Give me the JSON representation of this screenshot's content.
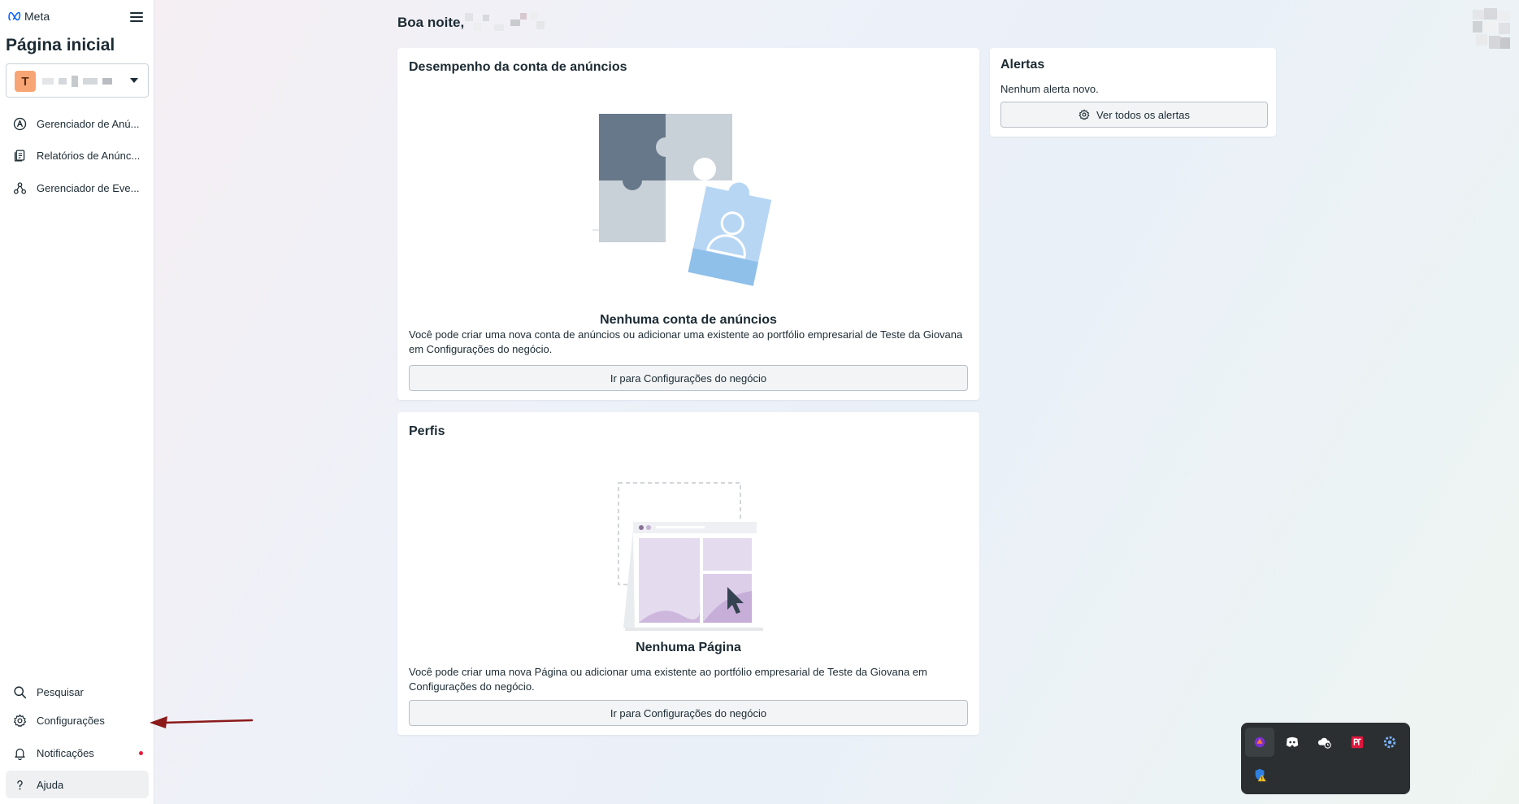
{
  "sidebar": {
    "brand": "Meta",
    "page_title": "Página inicial",
    "account_initial": "T",
    "nav_top": [
      {
        "label": "Gerenciador de Anú...",
        "icon": "ads-manager-icon"
      },
      {
        "label": "Relatórios de Anúnc...",
        "icon": "reports-icon"
      },
      {
        "label": "Gerenciador de Eve...",
        "icon": "events-manager-icon"
      }
    ],
    "nav_bottom": [
      {
        "label": "Pesquisar",
        "icon": "search-icon"
      },
      {
        "label": "Configurações",
        "icon": "gear-icon"
      },
      {
        "label": "Notificações",
        "icon": "bell-icon"
      },
      {
        "label": "Ajuda",
        "icon": "help-icon"
      }
    ]
  },
  "header": {
    "greeting": "Boa noite,"
  },
  "ad_performance": {
    "title": "Desempenho da conta de anúncios",
    "empty_title": "Nenhuma conta de anúncios",
    "description": "Você pode criar uma nova conta de anúncios ou adicionar uma existente ao portfólio empresarial de Teste da Giovana em Configurações do negócio.",
    "button_label": "Ir para Configurações do negócio"
  },
  "profiles": {
    "title": "Perfis",
    "empty_title": "Nenhuma Página",
    "description": "Você pode criar uma nova Página ou adicionar uma existente ao portfólio empresarial de Teste da Giovana em Configurações do negócio.",
    "button_label": "Ir para Configurações do negócio"
  },
  "alerts": {
    "title": "Alertas",
    "message": "Nenhum alerta novo.",
    "button_label": "Ver todos os alertas"
  },
  "tray": {
    "icons": [
      "app-purple-icon",
      "discord-icon",
      "cloud-sync-icon",
      "pdf-app-icon",
      "settings-gear-icon",
      "defender-warning-icon"
    ]
  },
  "colors": {
    "accent_dot": "#e41e3f",
    "avatar_bg": "#f7a574",
    "annotation_arrow": "#8b1a1a"
  }
}
